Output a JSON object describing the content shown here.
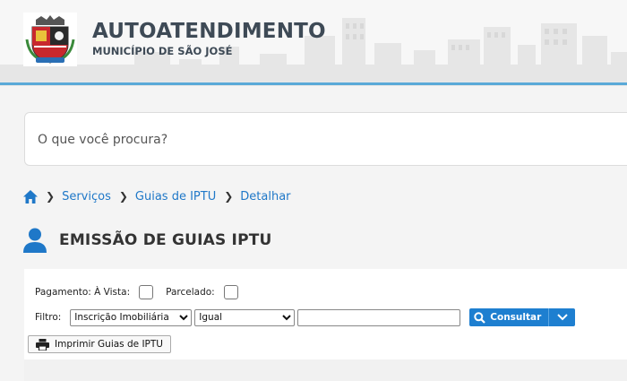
{
  "header": {
    "title": "AUTOATENDIMENTO",
    "subtitle": "MUNICÍPIO DE SÃO JOSÉ",
    "accent_color": "#5aa9d8",
    "logo_icon": "municipal-coat-of-arms"
  },
  "search": {
    "placeholder": "O que você procura?",
    "value": ""
  },
  "breadcrumb": {
    "home_icon": "home-icon",
    "items": [
      "Serviços",
      "Guias de IPTU",
      "Detalhar"
    ],
    "link_color": "#1f78c8"
  },
  "page": {
    "title": "EMISSÃO DE GUIAS IPTU",
    "icon": "user-icon"
  },
  "form": {
    "pagamento_label": "Pagamento: À Vista:",
    "pagamento_checked": false,
    "parcelado_label": "Parcelado:",
    "parcelado_checked": false,
    "filtro_label": "Filtro:",
    "filtro_field_selected": "Inscrição Imobiliária",
    "filtro_operator_selected": "Igual",
    "filtro_value": "",
    "consultar_label": "Consultar",
    "button_color": "#1e7fd0",
    "print_label": "Imprimir Guias de IPTU"
  }
}
